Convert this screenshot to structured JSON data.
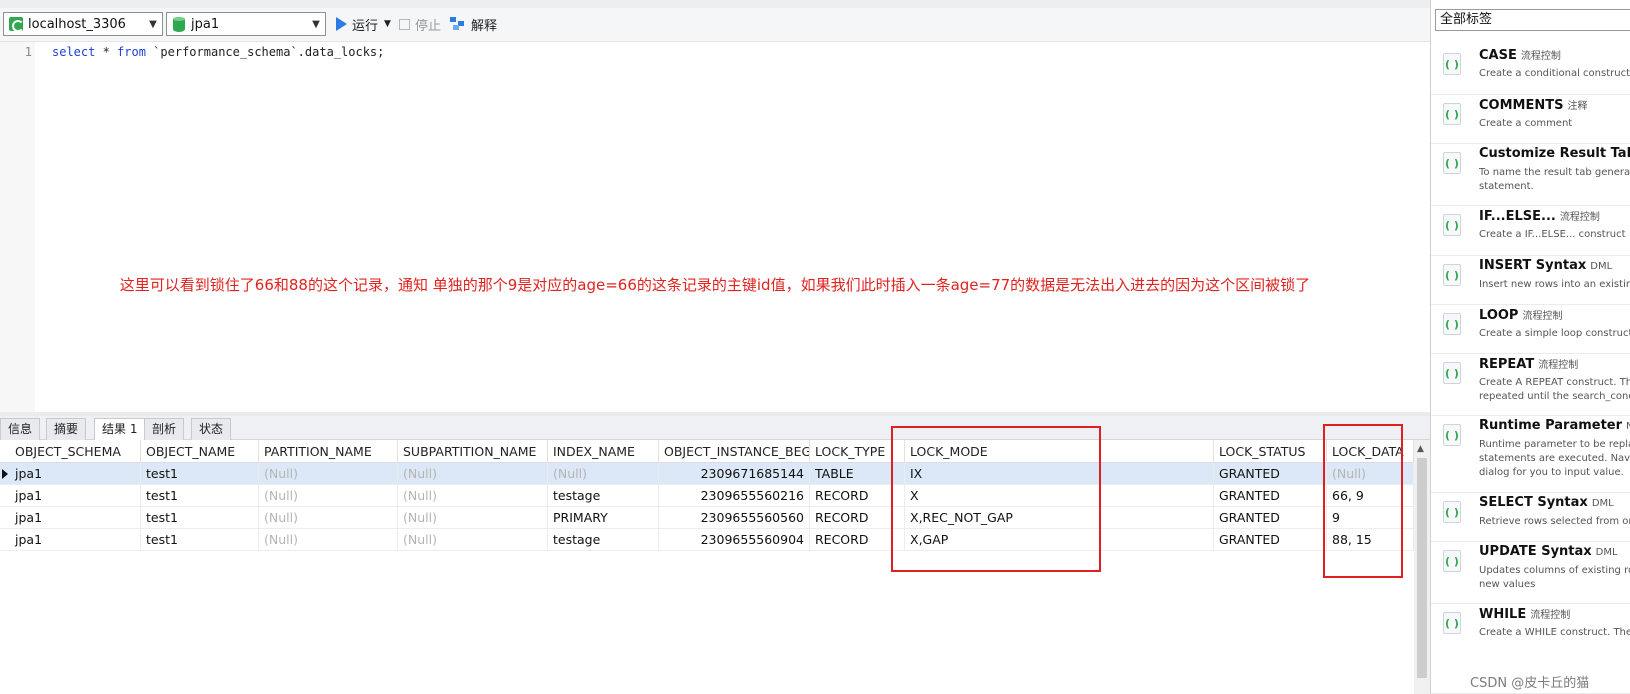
{
  "toolbar": {
    "connection": "localhost_3306",
    "database": "jpa1",
    "run_label": "运行",
    "stop_label": "停止",
    "explain_label": "解释"
  },
  "editor": {
    "line_number": "1",
    "code_kw1": "select",
    "code_mid1": " * ",
    "code_kw2": "from",
    "code_rest": " `performance_schema`.data_locks;",
    "annotation": "这里可以看到锁住了66和88的这个记录，通知 单独的那个9是对应的age=66的这条记录的主键id值，如果我们此时插入一条age=77的数据是无法出入进去的因为这个区间被锁了"
  },
  "tabs": [
    "信息",
    "摘要",
    "结果 1",
    "剖析",
    "状态"
  ],
  "active_tab": "结果 1",
  "grid": {
    "columns": [
      "OBJECT_SCHEMA",
      "OBJECT_NAME",
      "PARTITION_NAME",
      "SUBPARTITION_NAME",
      "INDEX_NAME",
      "OBJECT_INSTANCE_BEG",
      "LOCK_TYPE",
      "LOCK_MODE",
      "LOCK_STATUS",
      "LOCK_DATA"
    ],
    "rows": [
      [
        "jpa1",
        "test1",
        "(Null)",
        "(Null)",
        "(Null)",
        "2309671685144",
        "TABLE",
        "IX",
        "GRANTED",
        "(Null)"
      ],
      [
        "jpa1",
        "test1",
        "(Null)",
        "(Null)",
        "testage",
        "2309655560216",
        "RECORD",
        "X",
        "GRANTED",
        "66, 9"
      ],
      [
        "jpa1",
        "test1",
        "(Null)",
        "(Null)",
        "PRIMARY",
        "2309655560560",
        "RECORD",
        "X,REC_NOT_GAP",
        "GRANTED",
        "9"
      ],
      [
        "jpa1",
        "test1",
        "(Null)",
        "(Null)",
        "testage",
        "2309655560904",
        "RECORD",
        "X,GAP",
        "GRANTED",
        "88, 15"
      ]
    ]
  },
  "snippets": {
    "filter": "全部标签",
    "items": [
      {
        "title": "CASE",
        "tag": "流程控制",
        "desc": "Create a conditional construct"
      },
      {
        "title": "COMMENTS",
        "tag": "注释",
        "desc": "Create a comment"
      },
      {
        "title": "Customize Result Tab Na",
        "tag": "",
        "desc": "To name the result tab generated b statement."
      },
      {
        "title": "IF...ELSE...",
        "tag": "流程控制",
        "desc": "Create a IF...ELSE... construct"
      },
      {
        "title": "INSERT Syntax",
        "tag": "DML",
        "desc": "Insert new rows into an existing tab"
      },
      {
        "title": "LOOP",
        "tag": "流程控制",
        "desc": "Create a simple loop construct"
      },
      {
        "title": "REPEAT",
        "tag": "流程控制",
        "desc": "Create A REPEAT construct. The Sta repeated until the search_condition"
      },
      {
        "title": "Runtime Parameter",
        "tag": "Navica",
        "desc": "Runtime parameter to be replaced statements are executed. Navicat b dialog for you to input value."
      },
      {
        "title": "SELECT Syntax",
        "tag": "DML",
        "desc": "Retrieve rows selected from one or"
      },
      {
        "title": "UPDATE Syntax",
        "tag": "DML",
        "desc": "Updates columns of existing rows i with new values"
      },
      {
        "title": "WHILE",
        "tag": "流程控制",
        "desc": "Create a WHILE construct. The state"
      }
    ]
  },
  "watermark": "CSDN @皮卡丘的猫"
}
